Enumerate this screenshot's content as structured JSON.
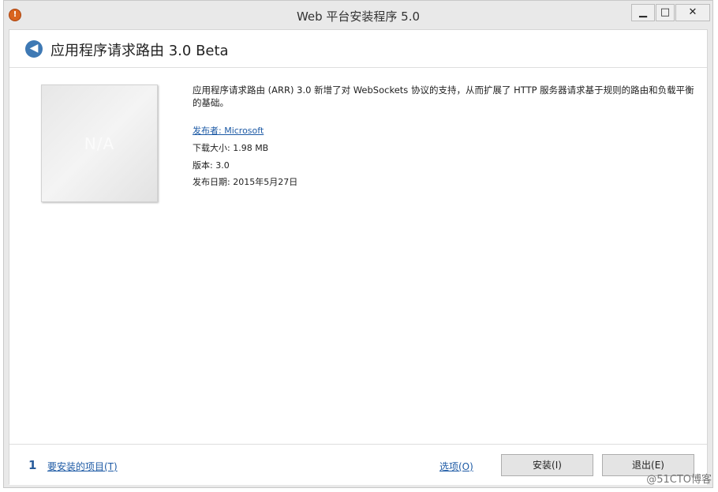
{
  "window": {
    "title": "Web 平台安装程序 5.0",
    "app_icon_glyph": "!",
    "minimize_glyph": "▁",
    "maximize_glyph": "□",
    "close_glyph": "✕"
  },
  "header": {
    "back_glyph": "◀",
    "title": "应用程序请求路由 3.0 Beta"
  },
  "product": {
    "thumbnail_text": "N/A",
    "description": "应用程序请求路由 (ARR) 3.0 新增了对 WebSockets 协议的支持，从而扩展了 HTTP 服务器请求基于规则的路由和负载平衡的基础。",
    "publisher_link": "发布者: Microsoft",
    "download_size": "下载大小: 1.98 MB",
    "version": "版本: 3.0",
    "release_date": "发布日期: 2015年5月27日"
  },
  "footer": {
    "count": "1",
    "items_link": "要安装的项目(T)",
    "options_link": "选项(O)",
    "install_label": "安装(I)",
    "exit_label": "退出(E)"
  },
  "watermark": "@51CTO博客"
}
